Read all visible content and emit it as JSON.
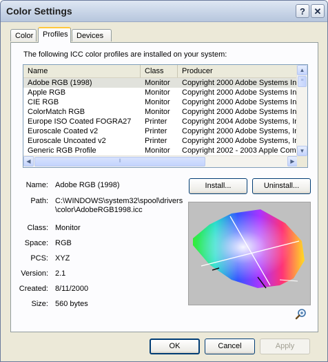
{
  "window": {
    "title": "Color Settings",
    "help_label": "?",
    "close_label": "✕"
  },
  "tabs": [
    {
      "label": "Color",
      "active": false
    },
    {
      "label": "Profiles",
      "active": true
    },
    {
      "label": "Devices",
      "active": false
    }
  ],
  "intro_text": "The following ICC color profiles are installed on your system:",
  "list": {
    "columns": {
      "name": "Name",
      "class": "Class",
      "producer": "Producer"
    },
    "rows": [
      {
        "name": "Adobe RGB (1998)",
        "class": "Monitor",
        "producer": "Copyright 2000 Adobe Systems Inc",
        "selected": true
      },
      {
        "name": "Apple RGB",
        "class": "Monitor",
        "producer": "Copyright 2000 Adobe Systems Inc"
      },
      {
        "name": "CIE RGB",
        "class": "Monitor",
        "producer": "Copyright 2000 Adobe Systems Inc"
      },
      {
        "name": "ColorMatch RGB",
        "class": "Monitor",
        "producer": "Copyright 2000 Adobe Systems Inc"
      },
      {
        "name": "Europe ISO Coated FOGRA27",
        "class": "Printer",
        "producer": "Copyright 2004 Adobe Systems, Inc"
      },
      {
        "name": "Euroscale Coated v2",
        "class": "Printer",
        "producer": "Copyright 2000 Adobe Systems, Inc"
      },
      {
        "name": "Euroscale Uncoated v2",
        "class": "Printer",
        "producer": "Copyright 2000 Adobe Systems, Inc"
      },
      {
        "name": "Generic RGB Profile",
        "class": "Monitor",
        "producer": "Copyright 2002 - 2003 Apple Comp"
      }
    ]
  },
  "details": {
    "name_label": "Name:",
    "name_value": "Adobe RGB (1998)",
    "path_label": "Path:",
    "path_line1": "C:\\WINDOWS\\system32\\spool\\drivers",
    "path_line2": "\\color\\AdobeRGB1998.icc",
    "class_label": "Class:",
    "class_value": "Monitor",
    "space_label": "Space:",
    "space_value": "RGB",
    "pcs_label": "PCS:",
    "pcs_value": "XYZ",
    "version_label": "Version:",
    "version_value": "2.1",
    "created_label": "Created:",
    "created_value": "8/11/2000",
    "size_label": "Size:",
    "size_value": "560 bytes"
  },
  "buttons": {
    "install": "Install...",
    "uninstall": "Uninstall...",
    "ok": "OK",
    "cancel": "Cancel",
    "apply": "Apply"
  },
  "icons": {
    "gamut_preview": "gamut-plot-icon",
    "zoom": "magnifier-icon"
  }
}
